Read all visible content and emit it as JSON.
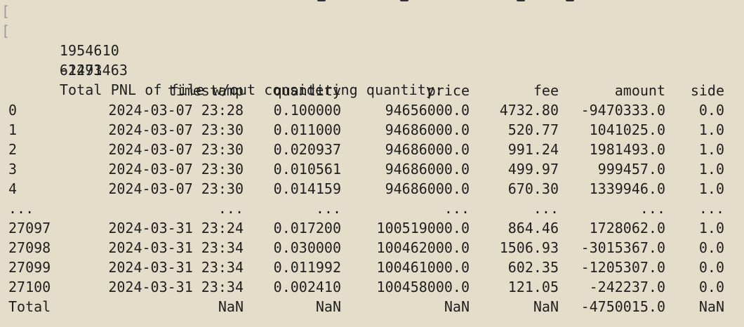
{
  "output": {
    "lines": [
      {
        "text": "1954610",
        "bracket": true
      },
      {
        "text": "61471",
        "bracket": true
      },
      {
        "text": "-2293463",
        "bracket": false
      },
      {
        "text": "Total PNL of file w/out considering quantity:",
        "bracket": false
      }
    ]
  },
  "table": {
    "columns": [
      "timestamp",
      "quantity",
      "price",
      "fee",
      "amount",
      "side"
    ],
    "rows": [
      {
        "index": "0",
        "timestamp": "2024-03-07 23:28",
        "quantity": "0.100000",
        "price": "94656000.0",
        "fee": "4732.80",
        "amount": "-9470333.0",
        "side": "0.0"
      },
      {
        "index": "1",
        "timestamp": "2024-03-07 23:30",
        "quantity": "0.011000",
        "price": "94686000.0",
        "fee": "520.77",
        "amount": "1041025.0",
        "side": "1.0"
      },
      {
        "index": "2",
        "timestamp": "2024-03-07 23:30",
        "quantity": "0.020937",
        "price": "94686000.0",
        "fee": "991.24",
        "amount": "1981493.0",
        "side": "1.0"
      },
      {
        "index": "3",
        "timestamp": "2024-03-07 23:30",
        "quantity": "0.010561",
        "price": "94686000.0",
        "fee": "499.97",
        "amount": "999457.0",
        "side": "1.0"
      },
      {
        "index": "4",
        "timestamp": "2024-03-07 23:30",
        "quantity": "0.014159",
        "price": "94686000.0",
        "fee": "670.30",
        "amount": "1339946.0",
        "side": "1.0"
      },
      {
        "index": "...",
        "timestamp": "...",
        "quantity": "...",
        "price": "...",
        "fee": "...",
        "amount": "...",
        "side": "..."
      },
      {
        "index": "27097",
        "timestamp": "2024-03-31 23:24",
        "quantity": "0.017200",
        "price": "100519000.0",
        "fee": "864.46",
        "amount": "1728062.0",
        "side": "1.0"
      },
      {
        "index": "27098",
        "timestamp": "2024-03-31 23:34",
        "quantity": "0.030000",
        "price": "100462000.0",
        "fee": "1506.93",
        "amount": "-3015367.0",
        "side": "0.0"
      },
      {
        "index": "27099",
        "timestamp": "2024-03-31 23:34",
        "quantity": "0.011992",
        "price": "100461000.0",
        "fee": "602.35",
        "amount": "-1205307.0",
        "side": "0.0"
      },
      {
        "index": "27100",
        "timestamp": "2024-03-31 23:34",
        "quantity": "0.002410",
        "price": "100458000.0",
        "fee": "121.05",
        "amount": "-242237.0",
        "side": "0.0"
      },
      {
        "index": "Total",
        "timestamp": "NaN",
        "quantity": "NaN",
        "price": "NaN",
        "fee": "NaN",
        "amount": "-4750015.0",
        "side": "NaN"
      }
    ]
  }
}
